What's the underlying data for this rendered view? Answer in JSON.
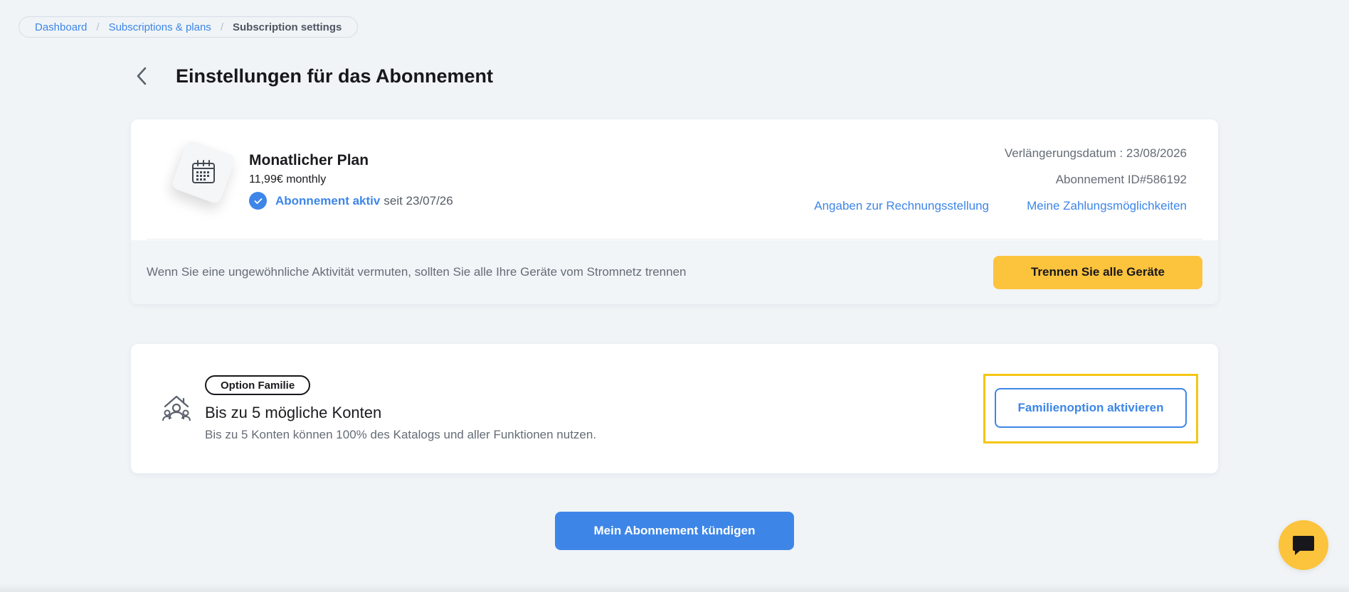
{
  "breadcrumb": {
    "items": [
      "Dashboard",
      "Subscriptions & plans"
    ],
    "current": "Subscription settings",
    "separator": "/"
  },
  "header": {
    "title": "Einstellungen für das Abonnement",
    "back_icon": "chevron-left-icon"
  },
  "plan": {
    "icon": "calendar-icon",
    "name": "Monatlicher Plan",
    "price": "11,99€ monthly",
    "status_icon": "check-circle-icon",
    "status_label": "Abonnement aktiv",
    "status_since": "seit 23/07/26",
    "renewal": "Verlängerungsdatum : 23/08/2026",
    "subscription_id": "Abonnement ID#586192",
    "billing_link": "Angaben zur Rechnungsstellung",
    "payment_link": "Meine Zahlungsmöglichkeiten"
  },
  "security": {
    "warning": "Wenn Sie eine ungewöhnliche Aktivität vermuten, sollten Sie alle Ihre Geräte vom Stromnetz trennen",
    "button": "Trennen Sie alle Geräte"
  },
  "family": {
    "icon": "family-home-icon",
    "badge": "Option Familie",
    "title": "Bis zu 5 mögliche Konten",
    "description": "Bis zu 5 Konten können 100% des Katalogs und aller Funktionen nutzen.",
    "button": "Familienoption aktivieren"
  },
  "footer": {
    "cancel_button": "Mein Abonnement kündigen"
  },
  "chat": {
    "icon": "chat-bubble-icon"
  },
  "colors": {
    "background": "#f0f4f7",
    "accent_blue": "#3d86e8",
    "accent_yellow": "#fcc33d",
    "highlight": "#f4c614"
  }
}
